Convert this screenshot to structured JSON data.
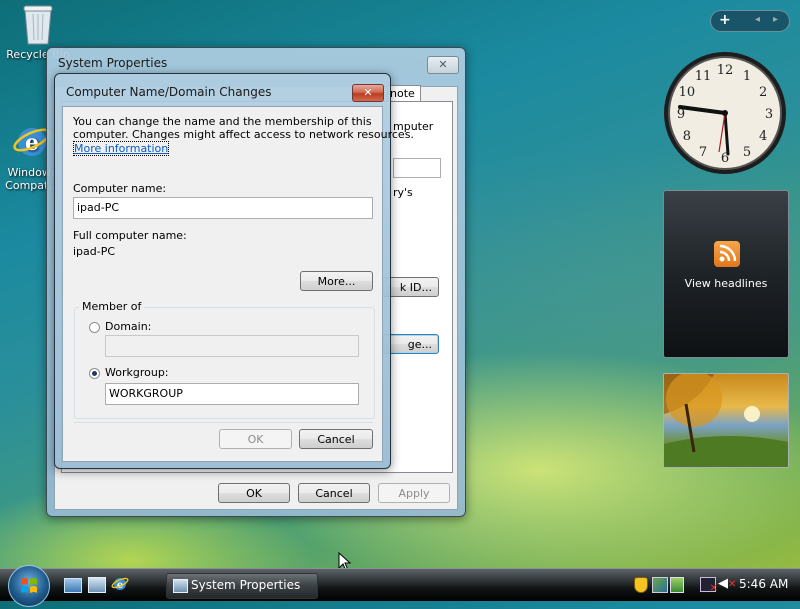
{
  "desktop": {
    "recycle_bin_label": "Recycle Bin",
    "ie_label_line1": "Windows",
    "ie_label_line2": "Compat..."
  },
  "system_properties": {
    "title": "System Properties",
    "tab_partial": "note",
    "text_partial_1": "mputer",
    "text_partial_2": "ry's",
    "network_id_partial": "k ID...",
    "change_partial": "ge...",
    "ok": "OK",
    "cancel": "Cancel",
    "apply": "Apply"
  },
  "dialog": {
    "title": "Computer Name/Domain Changes",
    "intro_line1": "You can change the name and the membership of this",
    "intro_line2": "computer. Changes might affect access to network resources.",
    "more_info_link": "More information",
    "computer_name_label": "Computer name:",
    "computer_name_value": "ipad-PC",
    "full_name_label": "Full computer name:",
    "full_name_value": "ipad-PC",
    "more_button": "More...",
    "member_of_label": "Member of",
    "domain_label": "Domain:",
    "domain_value": "",
    "workgroup_label": "Workgroup:",
    "workgroup_value": "WORKGROUP",
    "selected_membership": "Workgroup",
    "ok": "OK",
    "cancel": "Cancel"
  },
  "sidebar": {
    "feed_label": "View headlines"
  },
  "clock_numbers": [
    "12",
    "1",
    "2",
    "3",
    "4",
    "5",
    "6",
    "7",
    "8",
    "9",
    "10",
    "11"
  ],
  "taskbar": {
    "active_task": "System Properties",
    "time": "5:46 AM"
  }
}
